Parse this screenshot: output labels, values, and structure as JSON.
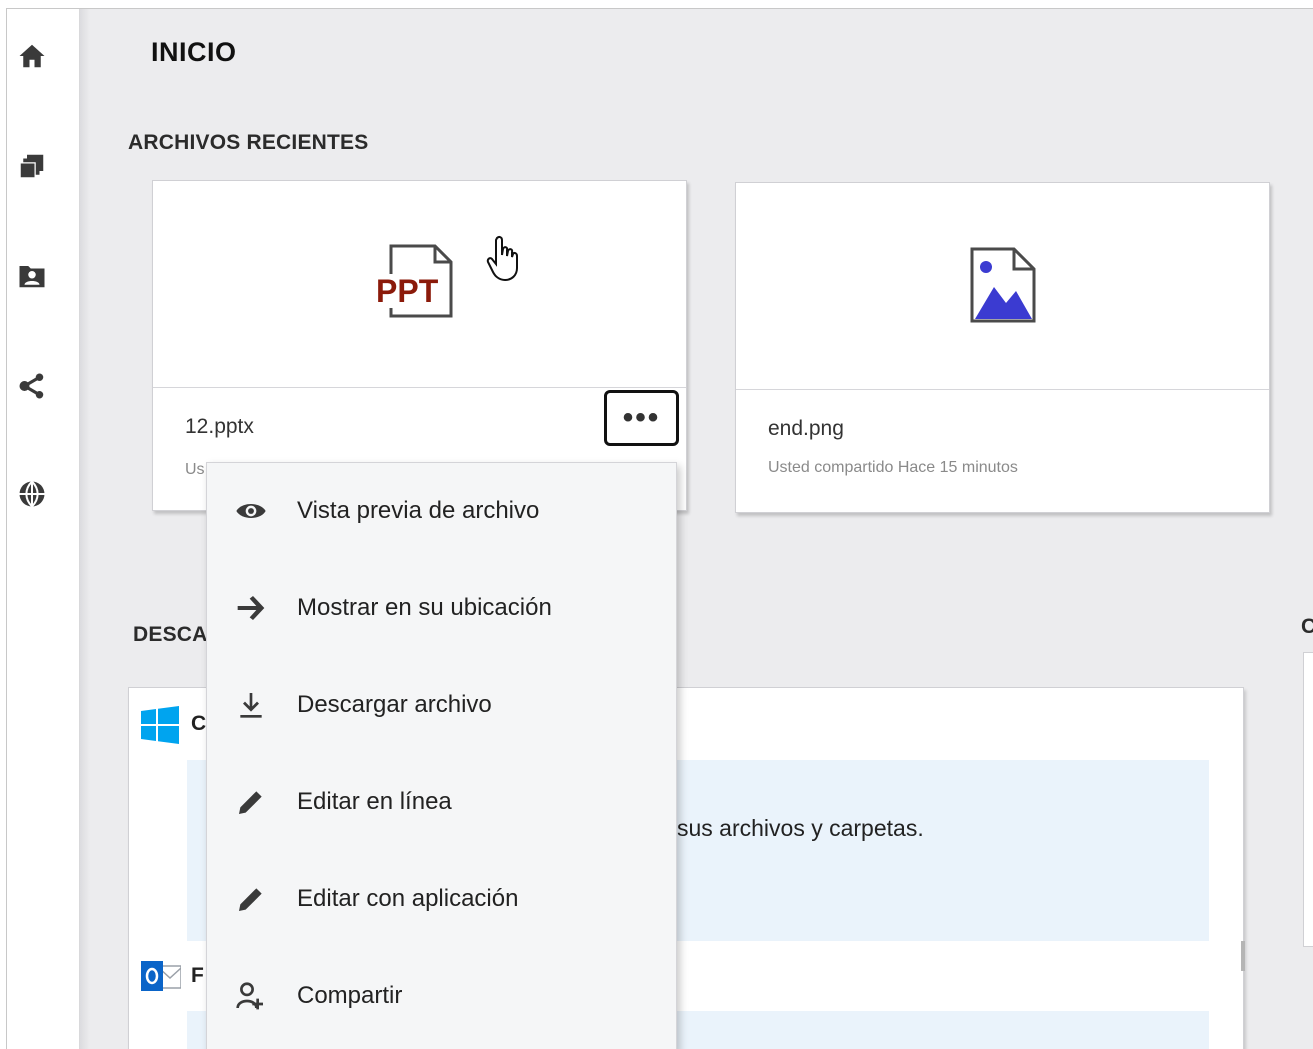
{
  "page": {
    "title": "INICIO"
  },
  "nav": [
    {
      "name": "home-icon"
    },
    {
      "name": "files-icon"
    },
    {
      "name": "net-folders-icon"
    },
    {
      "name": "shared-icon"
    },
    {
      "name": "public-icon"
    }
  ],
  "recent": {
    "title": "ARCHIVOS RECIENTES",
    "files": [
      {
        "name": "12.pptx",
        "meta": "Us",
        "icon": "ppt-file-icon",
        "icon_text": "PPT"
      },
      {
        "name": "end.png",
        "meta": "Usted compartido Hace 15 minutos",
        "icon": "image-file-icon"
      }
    ],
    "more_label": "•••"
  },
  "downloads": {
    "title": "DESCA",
    "windows_label": "C",
    "outlook_label": "F",
    "info_text": "sus archivos y carpetas."
  },
  "right_section": {
    "title": "C"
  },
  "context_menu": {
    "items": [
      {
        "label": "Vista previa de archivo",
        "icon": "eye-icon"
      },
      {
        "label": "Mostrar en su ubicación",
        "icon": "arrow-right-icon"
      },
      {
        "label": "Descargar archivo",
        "icon": "download-icon"
      },
      {
        "label": "Editar en línea",
        "icon": "pencil-icon"
      },
      {
        "label": "Editar con aplicación",
        "icon": "pencil-icon"
      },
      {
        "label": "Compartir",
        "icon": "share-user-icon"
      }
    ]
  },
  "colors": {
    "ppt_accent": "#8b1a0a",
    "image_accent": "#3b3bd1",
    "windows_blue": "#00a4ef",
    "outlook_blue": "#0a64c8"
  }
}
